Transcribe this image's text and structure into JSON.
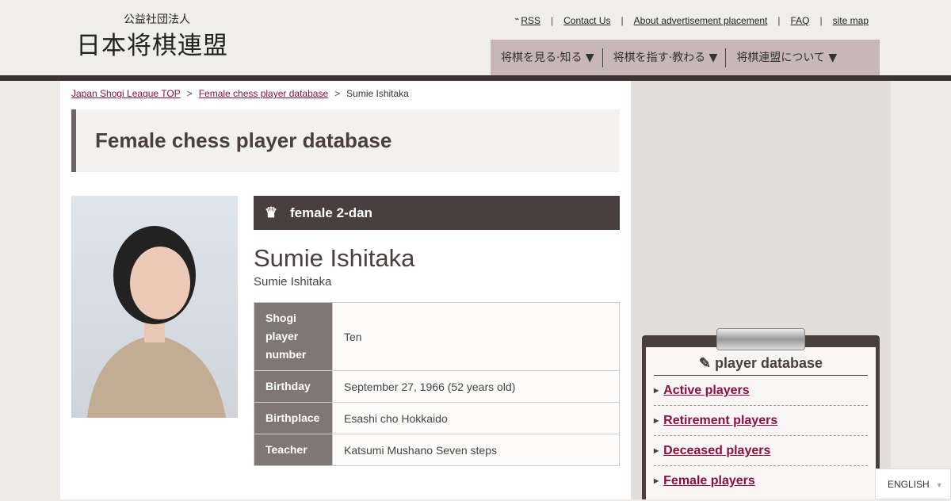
{
  "header": {
    "logo_small": "公益社団法人",
    "logo_big": "日本将棋連盟",
    "links": [
      "RSS",
      "Contact Us",
      "About advertisement placement",
      "FAQ",
      "site map"
    ],
    "nav": [
      "将棋を見る·知る ▼",
      "将棋を指す·教わる ▼",
      "将棋連盟について ▼"
    ]
  },
  "breadcrumb": [
    "Japan Shogi League TOP",
    "Female chess player database",
    "Sumie Ishitaka"
  ],
  "page_title": "Female chess player database",
  "player": {
    "rank": "female 2-dan",
    "name": "Sumie Ishitaka",
    "name_sub": "Sumie Ishitaka",
    "rows": [
      {
        "label": "Shogi player number",
        "value": "Ten"
      },
      {
        "label": "Birthday",
        "value": "September 27, 1966 (52 years old)"
      },
      {
        "label": "Birthplace",
        "value": "Esashi cho Hokkaido"
      },
      {
        "label": "Teacher",
        "value": "Katsumi Mushano Seven steps"
      }
    ]
  },
  "sidebar": {
    "title": "player database",
    "items": [
      "Active players",
      "Retirement players",
      "Deceased players",
      "Female players"
    ]
  },
  "language": "ENGLISH"
}
